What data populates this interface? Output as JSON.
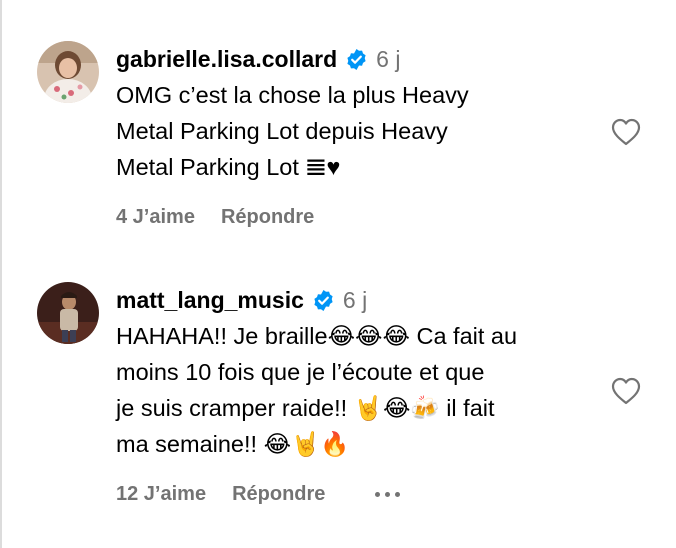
{
  "comments": [
    {
      "username": "gabrielle.lisa.collard",
      "time": "6 j",
      "text": "OMG c’est la chose la plus Heavy\nMetal Parking Lot depuis Heavy\nMetal Parking Lot 𝌆♥",
      "likes": "4 J’aime",
      "reply": "Répondre"
    },
    {
      "username": "matt_lang_music",
      "time": "6 j",
      "text": "HAHAHA!! Je braille😂😂😂 Ca fait au\nmoins 10 fois que je l’écoute et que\nje suis cramper raide!! 🤘😂🍻 il fait\nma semaine!! 😂🤘🔥",
      "likes": "12 J’aime",
      "reply": "Répondre"
    }
  ],
  "colors": {
    "verified": "#0095f6",
    "secondary": "#737373"
  },
  "icons": {
    "verified": "verified-badge-icon",
    "like": "heart-outline-icon",
    "more": "more-options-icon"
  }
}
